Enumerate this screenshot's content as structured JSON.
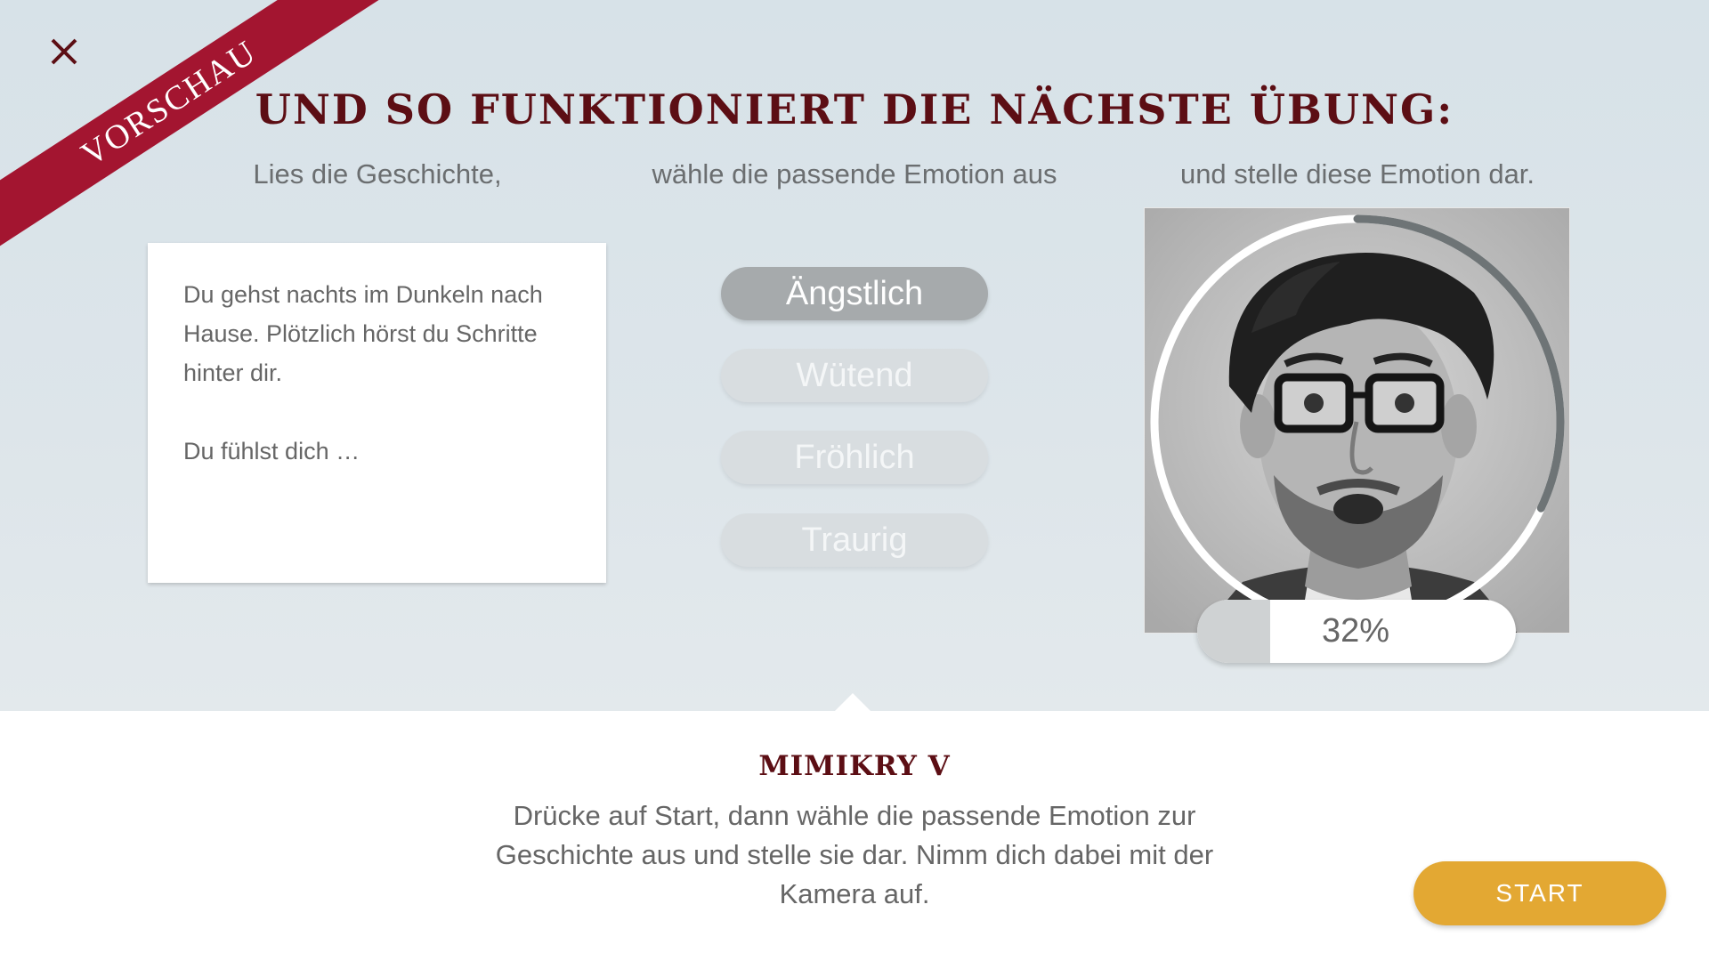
{
  "ribbon": {
    "label": "VORSCHAU"
  },
  "header": {
    "title": "UND SO FUNKTIONIERT DIE NÄCHSTE ÜBUNG:"
  },
  "steps": [
    {
      "label": "Lies die Geschichte,"
    },
    {
      "label": "wähle die passende Emotion aus"
    },
    {
      "label": "und stelle diese Emotion dar."
    }
  ],
  "story": {
    "text": "Du gehst nachts im Dunkeln nach Hause. Plötzlich hörst du Schritte hinter dir.",
    "prompt": "Du fühlst dich …"
  },
  "emotions": [
    {
      "label": "Ängstlich",
      "selected": true
    },
    {
      "label": "Wütend",
      "selected": false
    },
    {
      "label": "Fröhlich",
      "selected": false
    },
    {
      "label": "Traurig",
      "selected": false
    }
  ],
  "camera": {
    "progress_value": 0.32,
    "progress_label": "32%"
  },
  "exercise": {
    "title": "MIMIKRY V",
    "description": "Drücke auf Start, dann wähle die passende Emotion zur Geschichte aus und stelle sie dar. Nimm dich dabei mit der Kamera auf."
  },
  "actions": {
    "start_label": "START"
  },
  "colors": {
    "title": "#5c0e14",
    "ribbon": "#a31530",
    "start_button": "#e3a833",
    "selected_emotion": "#a6aaac"
  }
}
